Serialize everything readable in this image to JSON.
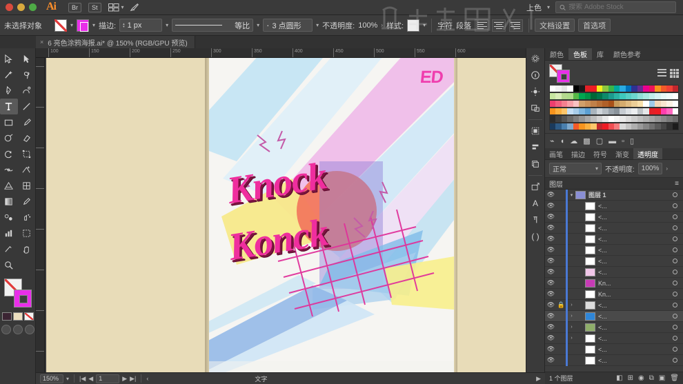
{
  "app": {
    "name": "Adobe Illustrator",
    "logo": "Ai"
  },
  "menubar": {
    "buttons": [
      "Br",
      "St"
    ],
    "arrange_icon": "arrange-documents-icon",
    "rocket_icon": "rocket-icon",
    "workspace_label": "上色",
    "search_placeholder": "搜索 Adobe Stock",
    "search_value": ""
  },
  "control_bar": {
    "selection_status": "未选择对象",
    "fill_swatch": "none",
    "stroke_swatch": "#e92ee9",
    "stroke_label": "描边:",
    "stroke_weight": "1 px",
    "profile_label": "等比",
    "brush_label": "3 点圆形",
    "opacity_label": "不透明度:",
    "opacity_value": "100%",
    "style_label": "样式:",
    "character_label": "字符",
    "paragraph_label": "段落",
    "document_setup_label": "文档设置",
    "preferences_label": "首选项"
  },
  "document_tab": {
    "title": "6 亮色涂鸦海报.ai* @ 150% (RGB/GPU 预览)",
    "close_label": "×"
  },
  "toolbar": {
    "tools": [
      {
        "name": "selection-tool",
        "glyph": "selection"
      },
      {
        "name": "direct-selection-tool",
        "glyph": "direct"
      },
      {
        "name": "magic-wand-tool",
        "glyph": "wand"
      },
      {
        "name": "lasso-tool",
        "glyph": "lasso"
      },
      {
        "name": "pen-tool",
        "glyph": "pen"
      },
      {
        "name": "curvature-tool",
        "glyph": "curve"
      },
      {
        "name": "type-tool",
        "glyph": "type",
        "active": true
      },
      {
        "name": "line-segment-tool",
        "glyph": "line"
      },
      {
        "name": "rectangle-tool",
        "glyph": "rect"
      },
      {
        "name": "paintbrush-tool",
        "glyph": "brush"
      },
      {
        "name": "shaper-tool",
        "glyph": "shaper"
      },
      {
        "name": "eraser-tool",
        "glyph": "eraser"
      },
      {
        "name": "rotate-tool",
        "glyph": "rotate"
      },
      {
        "name": "free-transform-tool",
        "glyph": "transform"
      },
      {
        "name": "width-tool",
        "glyph": "width"
      },
      {
        "name": "shape-builder-tool",
        "glyph": "shapebuilder"
      },
      {
        "name": "perspective-grid-tool",
        "glyph": "perspective"
      },
      {
        "name": "mesh-tool",
        "glyph": "mesh"
      },
      {
        "name": "gradient-tool",
        "glyph": "gradient"
      },
      {
        "name": "eyedropper-tool",
        "glyph": "eyedropper"
      },
      {
        "name": "blend-tool",
        "glyph": "blend"
      },
      {
        "name": "symbol-sprayer-tool",
        "glyph": "symbol"
      },
      {
        "name": "column-graph-tool",
        "glyph": "graph"
      },
      {
        "name": "artboard-tool",
        "glyph": "artboard"
      },
      {
        "name": "slice-tool",
        "glyph": "slice"
      },
      {
        "name": "hand-tool",
        "glyph": "hand"
      },
      {
        "name": "zoom-tool",
        "glyph": "zoom"
      }
    ],
    "fill_color": "none",
    "stroke_color": "#e92ee9",
    "mini_swatches": [
      "#3b2433",
      "#ecdfc0",
      "none"
    ]
  },
  "canvas": {
    "ruler_h_ticks": [
      "100",
      "150",
      "200",
      "250",
      "300",
      "350",
      "400",
      "450",
      "500",
      "550",
      "600"
    ],
    "ruler_v_ticks": [
      "50",
      "100",
      "150",
      "200",
      "250",
      "300",
      "350",
      "400"
    ],
    "artwork": {
      "headline_line1": "Knock",
      "headline_line2": "Konck",
      "badge": "ED",
      "headline_color": "#ef2e9e",
      "badge_color": "#ef3fae",
      "grid_color": "#e0339b",
      "palette": [
        "#bfe3f5",
        "#efb8e8",
        "#f7e98a",
        "#f2795e",
        "#9b8ae0",
        "#7fbce8"
      ]
    }
  },
  "right_rail": {
    "icons": [
      "gear-icon",
      "info-icon",
      "brightness-icon",
      "artboards-icon",
      "pathfinder-icon",
      "align-icon",
      "layers-stack-icon",
      "transform-icon",
      "character-a-icon",
      "paragraph-icon",
      "parentheses-icon"
    ]
  },
  "panels": {
    "color_tabs": [
      {
        "label": "颜色",
        "active": false
      },
      {
        "label": "色板",
        "active": true
      },
      {
        "label": "库",
        "active": false
      },
      {
        "label": "颜色参考",
        "active": false
      }
    ],
    "swatch_view_icons": [
      "list-view-icon",
      "grid-view-icon"
    ],
    "swatch_rows": [
      [
        "#ffffff",
        "#f2f2f2",
        "#e5e5e5",
        "#ffffff",
        "#000000",
        "#1a1a1a",
        "#e32027",
        "#ed1c24",
        "#f5ec1c",
        "#8dc63f",
        "#39b54a",
        "#00a99d",
        "#29abe2",
        "#0071bc",
        "#2e3192",
        "#662d91",
        "#ec008c",
        "#ed145b",
        "#f7941e",
        "#f15a29",
        "#ef4136",
        "#c1272d"
      ],
      [
        "#c7e5a0",
        "#d9ecb8",
        "#b5d98f",
        "#aedb8a",
        "#57b947",
        "#00a651",
        "#009245",
        "#006837",
        "#00754a",
        "#0d8a6a",
        "#1b9b8e",
        "#2bb3a3",
        "#3ec9bd",
        "#57d0c6",
        "#6cd7cf",
        "#8fe0d8",
        "#a7e7e0",
        "#c0eeea",
        "#d6f4f1",
        "#e6f8f6",
        "#f0fbfa",
        "#ffffff"
      ],
      [
        "#ed3e6e",
        "#f05f7e",
        "#f4808f",
        "#f7a1a8",
        "#fac2c2",
        "#d1a06b",
        "#c9905a",
        "#c08049",
        "#b87038",
        "#b06028",
        "#a85018",
        "#c79a5a",
        "#d4ab6e",
        "#e0bc82",
        "#ecce97",
        "#f8dfab",
        "#ffffff",
        "#9ecae8",
        "#f2d7b8",
        "#f8e7cf",
        "#fdf3e6",
        "#ffffff"
      ],
      [
        "#f7941e",
        "#fbb040",
        "#fdc66b",
        "#c5dff5",
        "#a8cdea",
        "#7fb6de",
        "#5b9fd2",
        "#a9b4bd",
        "#cfd5da",
        "#b7bec4",
        "#9aa3ab",
        "#8a939b",
        "#c6ccd2",
        "#dde1e5",
        "#eceef0",
        "#bfc4c8",
        "#e5e7e9",
        "#e32027",
        "#ed1c24",
        "#ff3fae",
        "#ff6ac1",
        "#ffffff"
      ],
      [
        "#2b2b2b",
        "#3f3f3f",
        "#545454",
        "#6a6a6a",
        "#7f7f7f",
        "#949494",
        "#a9a9a9",
        "#bebebe",
        "#d3d3d3",
        "#e8e8e8",
        "#ffffff",
        "#f4f4f4",
        "#eaeaea",
        "#dcdcdc",
        "#cecece",
        "#c0c0c0",
        "#b2b2b2",
        "#a4a4a4",
        "#969696",
        "#888888",
        "#7a7a7a",
        "#6c6c6c"
      ],
      [
        "#1b3a5c",
        "#2e5b86",
        "#4a7fae",
        "#7fa9cd",
        "#f15a29",
        "#f7941e",
        "#fbb040",
        "#fdc66b",
        "#c1272d",
        "#ed1c24",
        "#f04e52",
        "#f47c7e",
        "#d9d9d9",
        "#c4c4c4",
        "#afafaf",
        "#9a9a9a",
        "#858585",
        "#707070",
        "#5b5b5b",
        "#464646",
        "#313131",
        "#1c1c1c"
      ]
    ],
    "transparency_tabs": [
      {
        "label": "画笔",
        "active": false
      },
      {
        "label": "描边",
        "active": false
      },
      {
        "label": "符号",
        "active": false
      },
      {
        "label": "渐变",
        "active": false
      },
      {
        "label": "透明度",
        "active": true
      }
    ],
    "blend_mode": "正常",
    "opacity_label": "不透明度:",
    "opacity_value": "100%"
  },
  "layers_panel": {
    "title": "图层",
    "menu_icon": "panel-menu-icon",
    "rows": [
      {
        "name": "图层 1",
        "thumb": "#8a8fd4",
        "root": true,
        "expanded": true,
        "locked": false,
        "selected": false
      },
      {
        "name": "<...",
        "thumb": "#ffffff",
        "root": false,
        "expanded": false,
        "locked": false,
        "selected": false
      },
      {
        "name": "<...",
        "thumb": "#ffffff",
        "root": false,
        "expanded": false,
        "locked": false,
        "selected": false
      },
      {
        "name": "<...",
        "thumb": "#ffffff",
        "root": false,
        "expanded": false,
        "locked": false,
        "selected": false
      },
      {
        "name": "<...",
        "thumb": "#ffffff",
        "root": false,
        "expanded": false,
        "locked": false,
        "selected": false
      },
      {
        "name": "<...",
        "thumb": "#ffffff",
        "root": false,
        "expanded": false,
        "locked": false,
        "selected": false
      },
      {
        "name": "<...",
        "thumb": "#ffffff",
        "root": false,
        "expanded": false,
        "locked": false,
        "selected": false
      },
      {
        "name": "<...",
        "thumb": "#f0c6e8",
        "root": false,
        "expanded": false,
        "locked": false,
        "selected": false
      },
      {
        "name": "Kn...",
        "thumb": "#c73bb5",
        "root": false,
        "expanded": false,
        "locked": false,
        "selected": false
      },
      {
        "name": "Kn...",
        "thumb": "#ffffff",
        "root": false,
        "expanded": false,
        "locked": false,
        "selected": false
      },
      {
        "name": "<...",
        "thumb": "#dcdcdc",
        "root": false,
        "expanded": true,
        "locked": true,
        "selected": false
      },
      {
        "name": "<...",
        "thumb": "#2f86d8",
        "root": false,
        "expanded": true,
        "locked": false,
        "selected": true
      },
      {
        "name": "<...",
        "thumb": "#8fae6a",
        "root": false,
        "expanded": true,
        "locked": false,
        "selected": false
      },
      {
        "name": "<...",
        "thumb": "#ffffff",
        "root": false,
        "expanded": true,
        "locked": false,
        "selected": false
      },
      {
        "name": "<...",
        "thumb": "#ffffff",
        "root": false,
        "expanded": false,
        "locked": false,
        "selected": false
      },
      {
        "name": "<...",
        "thumb": "#ffffff",
        "root": false,
        "expanded": false,
        "locked": false,
        "selected": false
      }
    ],
    "footer_count": "1 个图层",
    "footer_icons": [
      "make-clipping-mask-icon",
      "create-sublayer-icon",
      "create-new-layer-icon",
      "delete-layer-icon"
    ]
  },
  "status_bar": {
    "zoom": "150%",
    "artboard_nav": "1",
    "tool_status": "文字"
  }
}
